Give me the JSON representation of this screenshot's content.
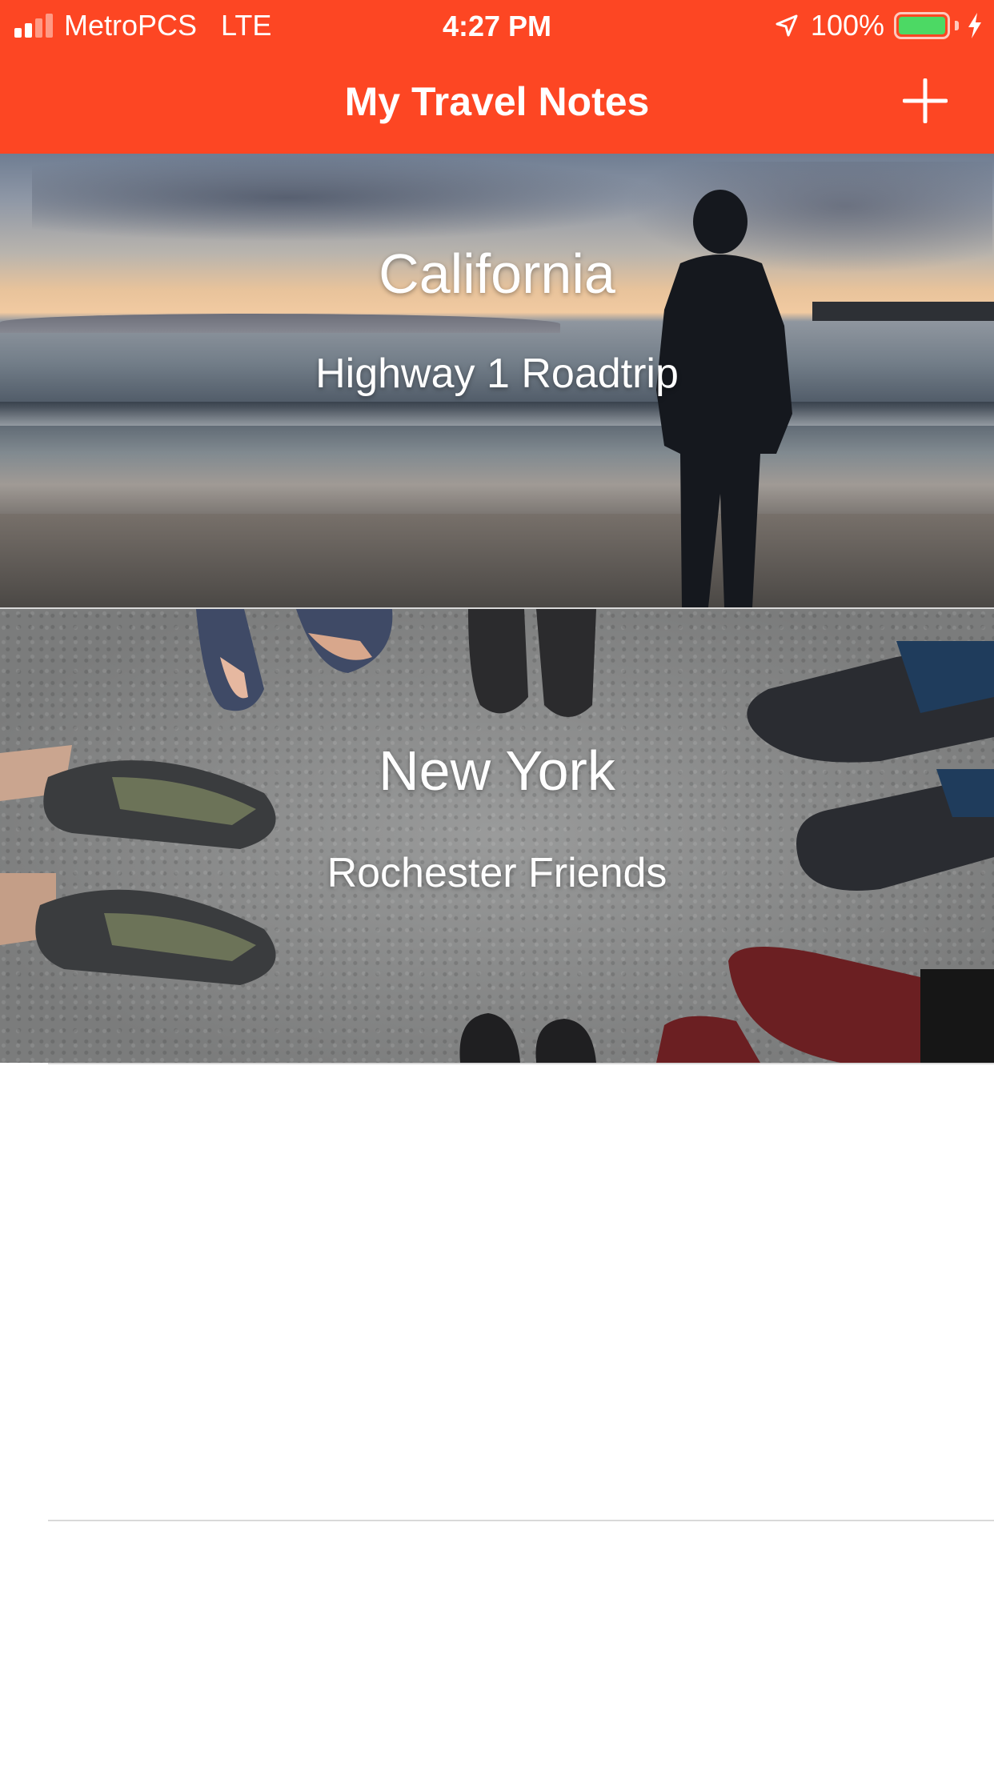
{
  "status_bar": {
    "carrier": "MetroPCS",
    "network": "LTE",
    "time": "4:27 PM",
    "battery_percent": "100%",
    "battery_level": 1.0,
    "battery_color": "#4cd964",
    "signal_bars_filled": 2,
    "signal_bars_total": 4,
    "icons": [
      "location-arrow-icon",
      "battery-icon",
      "charging-bolt-icon"
    ]
  },
  "nav": {
    "title": "My Travel Notes",
    "add_icon": "plus-icon",
    "background_color": "#fd4623"
  },
  "trips": [
    {
      "title": "California",
      "subtitle": "Highway 1 Roadtrip"
    },
    {
      "title": "New York",
      "subtitle": "Rochester Friends"
    }
  ]
}
